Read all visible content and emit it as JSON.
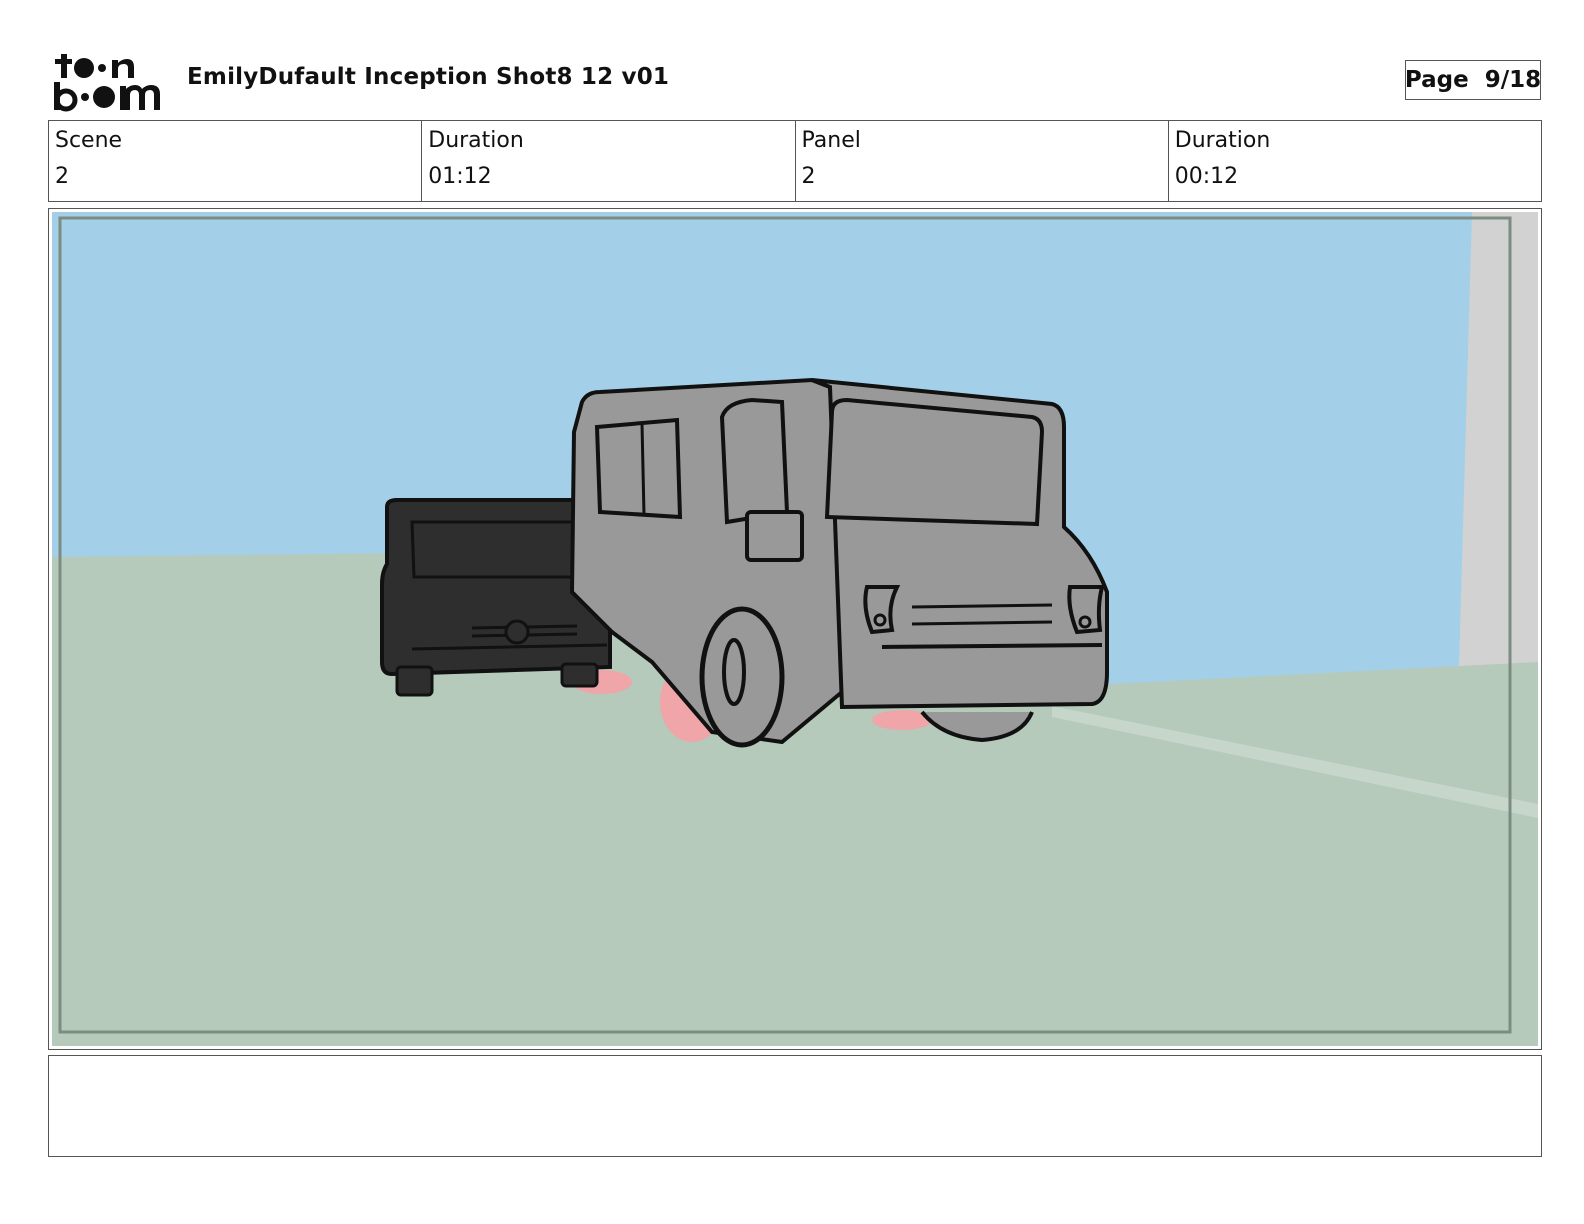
{
  "header": {
    "logo_text": "toon boom",
    "title": "EmilyDufault Inception Shot8 12 v01",
    "page_label": "Page",
    "page_value": "9/18"
  },
  "info": {
    "scene_label": "Scene",
    "scene_value": "2",
    "scene_duration_label": "Duration",
    "scene_duration_value": "01:12",
    "panel_label": "Panel",
    "panel_value": "2",
    "panel_duration_label": "Duration",
    "panel_duration_value": "00:12"
  },
  "panel": {
    "sky_color": "#a3d0e8",
    "ground_color": "#b5cabb",
    "truck_color": "#999999",
    "car_color": "#2e2e2e",
    "wheel_shadow_color": "#f0a5a8"
  },
  "caption": {
    "text": ""
  }
}
